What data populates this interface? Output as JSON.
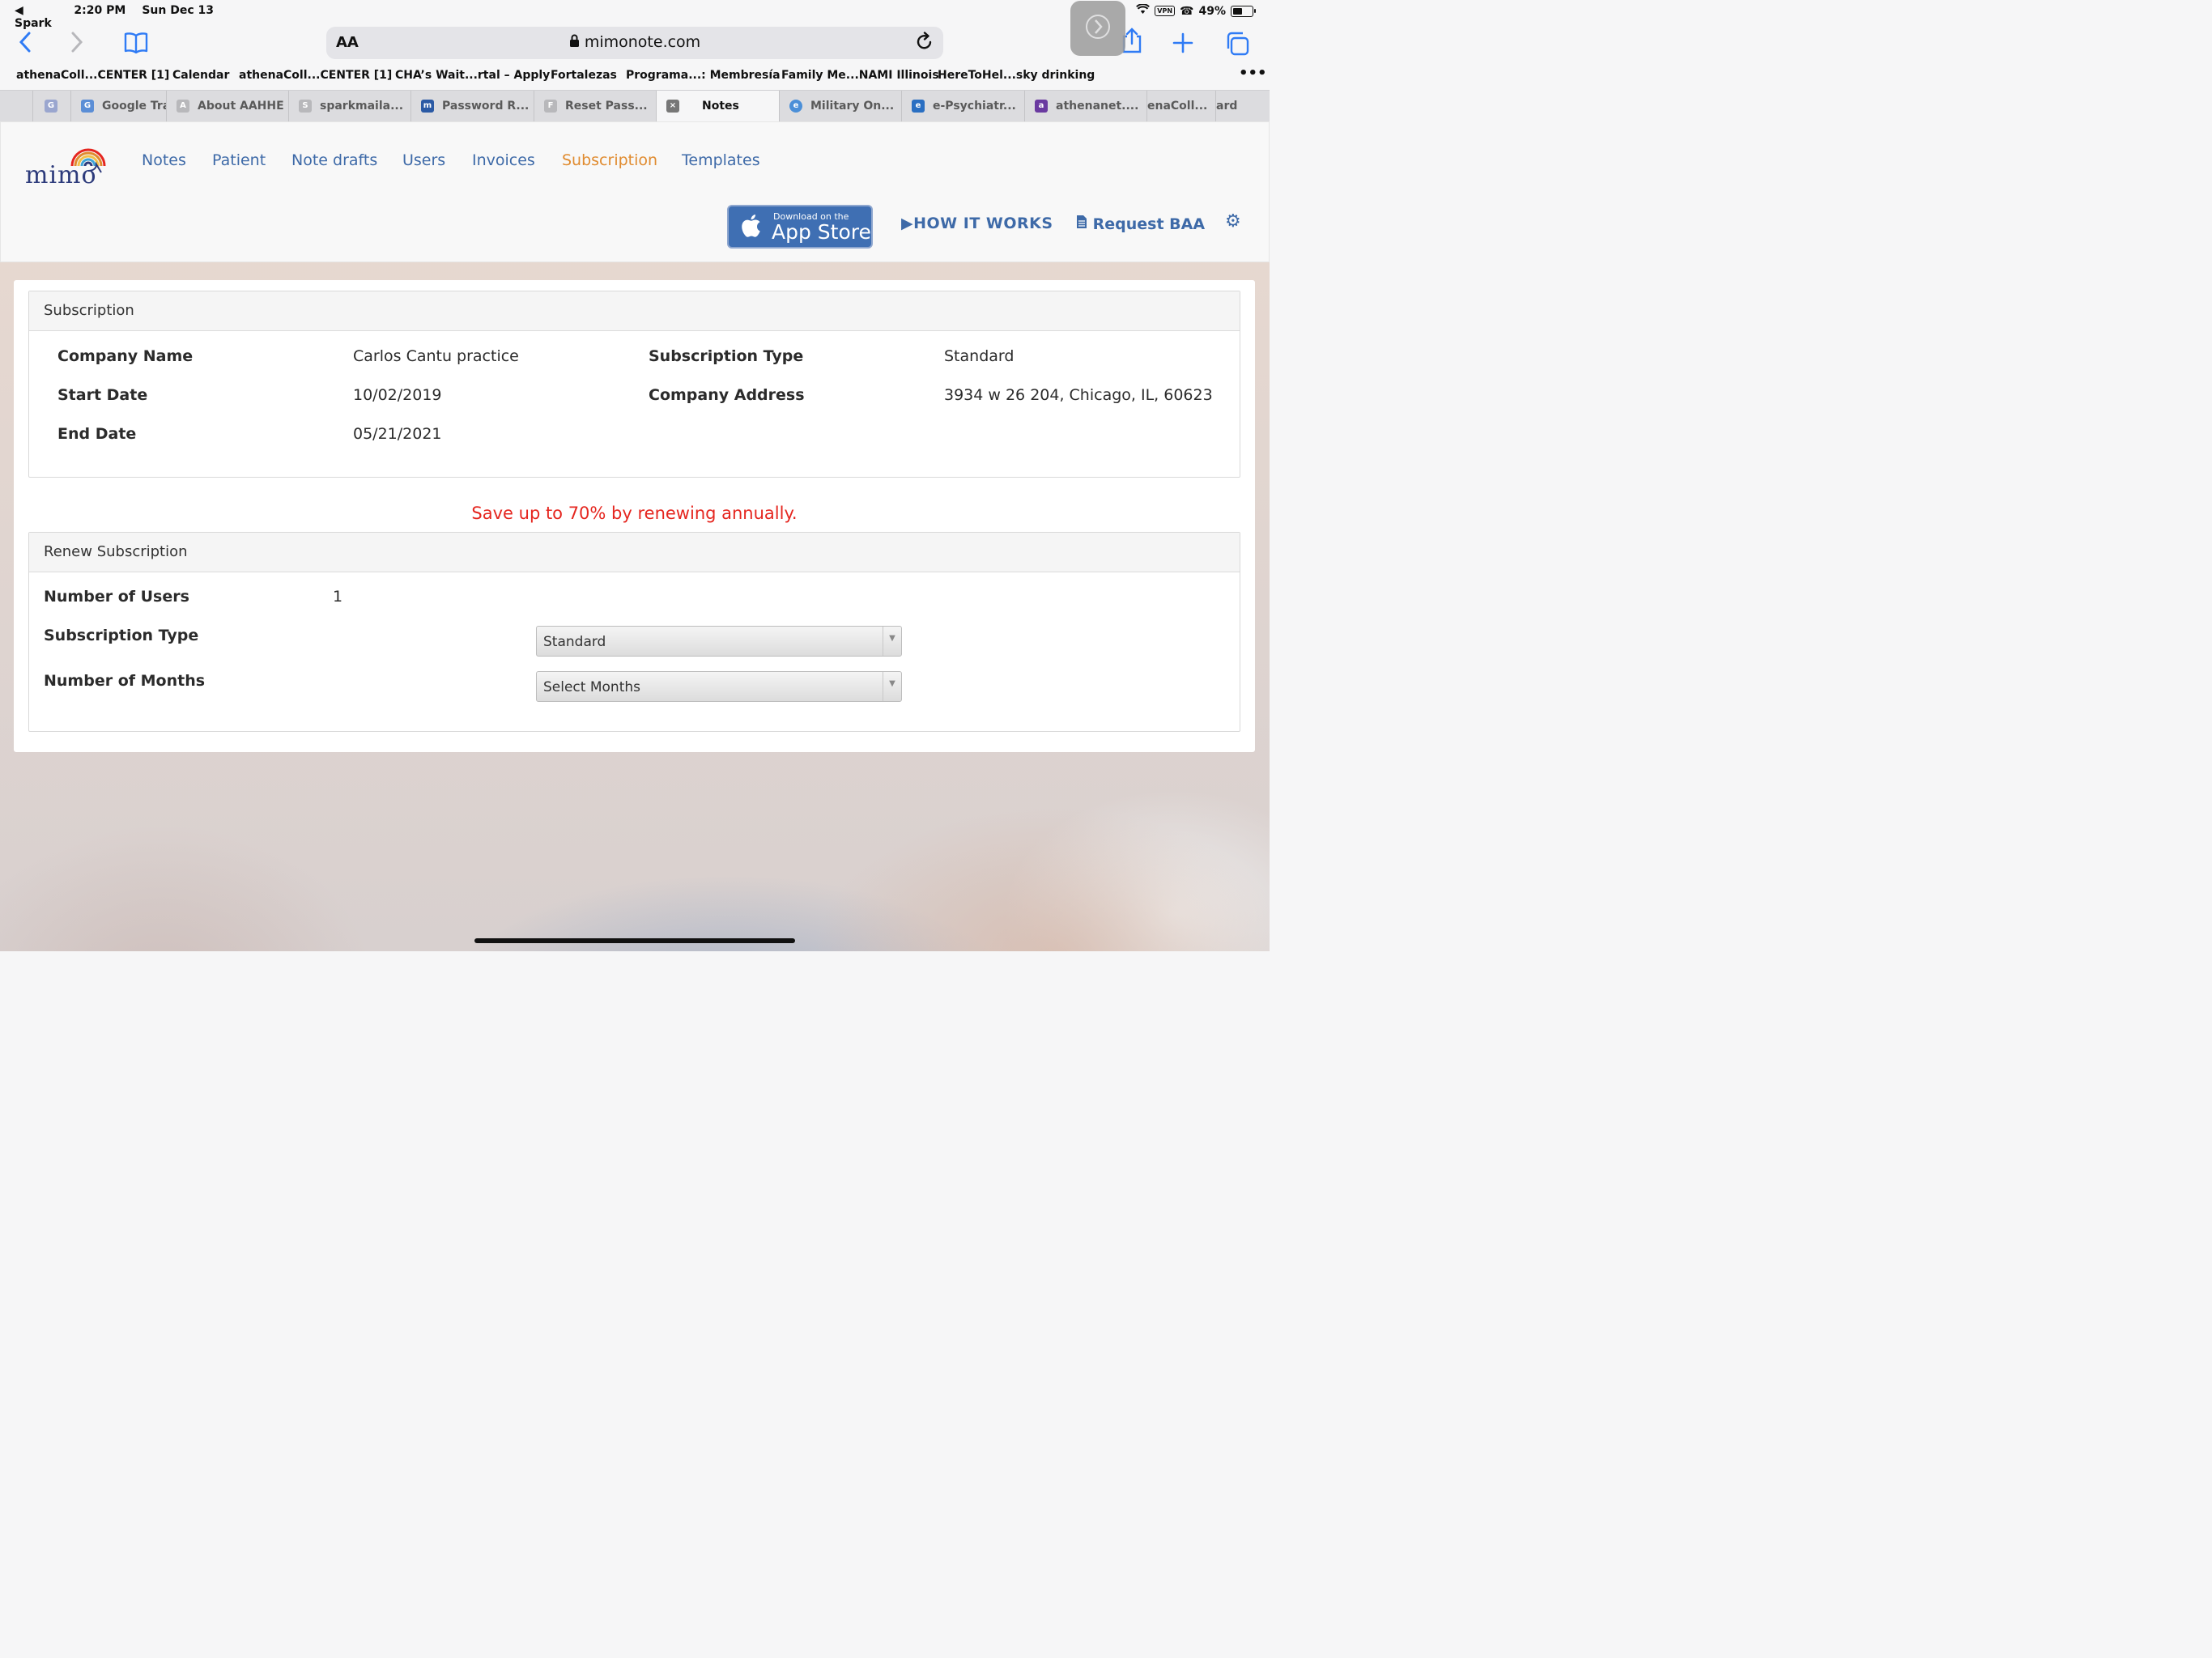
{
  "status": {
    "back_app": "Spark",
    "time": "2:20 PM",
    "date": "Sun Dec 13",
    "vpn": "VPN",
    "battery": "49%"
  },
  "safari": {
    "text_size": "AA",
    "url": "mimonote.com"
  },
  "bookmarks": [
    "athenaColl...CENTER [1]",
    "Calendar",
    "athenaColl...CENTER [1]",
    "CHA’s Wait...rtal – Apply",
    "Fortalezas",
    "Programa...: Membresía",
    "Family Me...NAMI Illinois",
    "HereToHel...sky drinking"
  ],
  "tabs": [
    {
      "label": "",
      "icon": "G"
    },
    {
      "label": "Google Tra",
      "icon": "G"
    },
    {
      "label": "About AAHHE",
      "icon": "A"
    },
    {
      "label": "sparkmaila...",
      "icon": "S"
    },
    {
      "label": "Password R...",
      "icon": "m"
    },
    {
      "label": "Reset Pass...",
      "icon": "F"
    },
    {
      "label": "Notes",
      "icon": "×"
    },
    {
      "label": "Military On...",
      "icon": "e"
    },
    {
      "label": "e-Psychiatr...",
      "icon": "e"
    },
    {
      "label": "athenanet....",
      "icon": "a"
    },
    {
      "label": "enaColl...",
      "icon": ""
    },
    {
      "label": "ard",
      "icon": ""
    }
  ],
  "site": {
    "logo": "mimo",
    "nav": [
      "Notes",
      "Patient",
      "Note drafts",
      "Users",
      "Invoices",
      "Subscription",
      "Templates"
    ],
    "active_nav": "Subscription",
    "appstore_small": "Download on the",
    "appstore_big": "App Store",
    "how_it_works": "HOW IT WORKS",
    "request_baa": "Request BAA"
  },
  "subscription": {
    "title": "Subscription",
    "company_name_label": "Company Name",
    "company_name": "Carlos Cantu practice",
    "start_date_label": "Start Date",
    "start_date": "10/02/2019",
    "end_date_label": "End Date",
    "end_date": "05/21/2021",
    "type_label": "Subscription Type",
    "type": "Standard",
    "address_label": "Company Address",
    "address": "3934 w 26 204, Chicago, IL, 60623"
  },
  "promo": "Save up to 70% by renewing annually.",
  "renew": {
    "title": "Renew Subscription",
    "users_label": "Number of Users",
    "users": "1",
    "type_label": "Subscription Type",
    "type_value": "Standard",
    "months_label": "Number of Months",
    "months_value": "Select Months"
  },
  "colors": {
    "link": "#3e6aa8",
    "active": "#e08b2f",
    "promo": "#e5261f",
    "safari_blue": "#2f7bf5"
  }
}
